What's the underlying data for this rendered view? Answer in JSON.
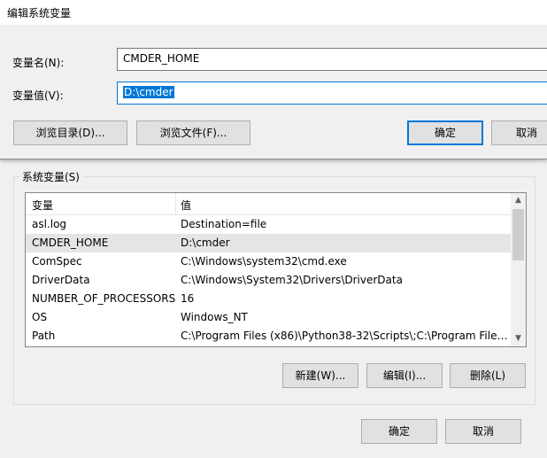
{
  "dialog": {
    "title": "编辑系统变量",
    "name_label": "变量名(N):",
    "name_value": "CMDER_HOME",
    "value_label": "变量值(V):",
    "value_value": "D:\\cmder",
    "browse_dir_label": "浏览目录(D)...",
    "browse_file_label": "浏览文件(F)...",
    "ok_label": "确定",
    "cancel_label": "取消"
  },
  "system_vars": {
    "group_label": "系统变量(S)",
    "columns": [
      "变量",
      "值"
    ],
    "rows": [
      {
        "name": "asl.log",
        "value": "Destination=file"
      },
      {
        "name": "CMDER_HOME",
        "value": "D:\\cmder",
        "selected": true
      },
      {
        "name": "ComSpec",
        "value": "C:\\Windows\\system32\\cmd.exe"
      },
      {
        "name": "DriverData",
        "value": "C:\\Windows\\System32\\Drivers\\DriverData"
      },
      {
        "name": "NUMBER_OF_PROCESSORS",
        "value": "16"
      },
      {
        "name": "OS",
        "value": "Windows_NT"
      },
      {
        "name": "Path",
        "value": "C:\\Program Files (x86)\\Python38-32\\Scripts\\;C:\\Program Files ..."
      }
    ],
    "new_label": "新建(W)...",
    "edit_label": "编辑(I)...",
    "delete_label": "删除(L)"
  },
  "footer": {
    "ok_label": "确定",
    "cancel_label": "取消"
  }
}
